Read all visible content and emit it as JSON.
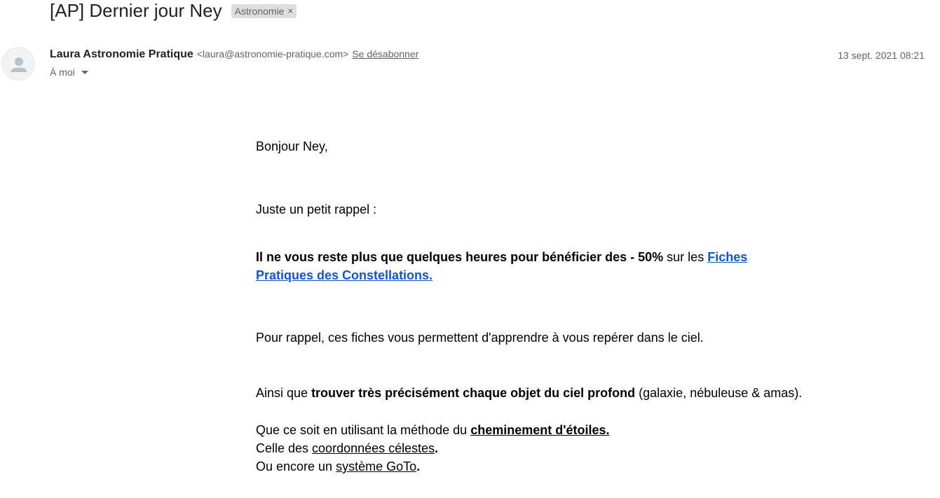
{
  "email": {
    "subject": "[AP] Dernier jour Ney",
    "label": "Astronomie",
    "label_close": "×",
    "sender_name": "Laura Astronomie Pratique",
    "sender_email": "<laura@astronomie-pratique.com>",
    "unsubscribe": "Se désabonner",
    "date": "13 sept. 2021 08:21",
    "to": "À moi"
  },
  "body": {
    "greeting": "Bonjour Ney,",
    "reminder": "Juste un petit rappel :",
    "offer_bold": "Il ne vous reste plus que quelques heures pour bénéficier des - 50%",
    "offer_mid": " sur les ",
    "offer_link_line1": "Fiches",
    "offer_link_line2": "Pratiques des Constellations.",
    "purpose": "Pour rappel, ces fiches vous permettent d'apprendre à vous repérer dans le ciel.",
    "also_prefix": "Ainsi que ",
    "also_bold": "trouver très précisément chaque objet du ciel profond",
    "also_suffix": " (galaxie, nébuleuse & amas).",
    "method_prefix": "Que ce soit en utilisant la méthode du ",
    "method_link": "cheminement d'étoiles.",
    "coords_prefix": "Celle des ",
    "coords_link": "coordonnées célestes",
    "coords_suffix": ".",
    "goto_prefix": "Ou encore un ",
    "goto_link": "système GoTo",
    "goto_suffix": "."
  },
  "icons": {
    "avatar": "person-icon",
    "label_remove": "close-icon",
    "recipients": "chevron-down-icon"
  },
  "colors": {
    "link": "#1155cc",
    "chip_bg": "#dddddd",
    "meta_text": "#5f6368"
  }
}
